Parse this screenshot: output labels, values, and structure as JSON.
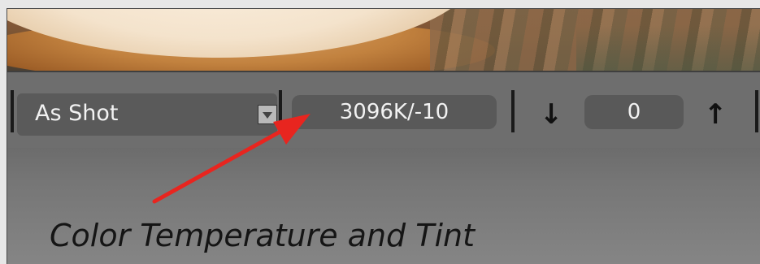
{
  "white_balance": {
    "preset_label": "As Shot",
    "dropdown_icon": "triangle-down-icon",
    "temp_tint_value": "3096K/-10",
    "exposure_value": "0",
    "decrease_icon": "↓",
    "increase_icon": "↑"
  },
  "annotation": {
    "caption": "Color Temperature and Tint",
    "arrow_color": "#e8251f"
  }
}
